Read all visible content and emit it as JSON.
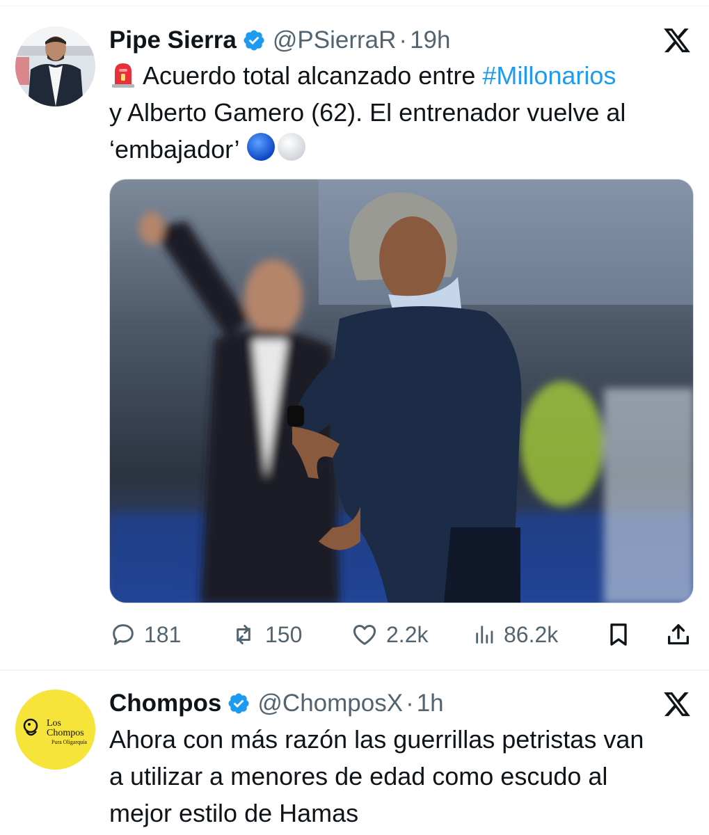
{
  "tweets": [
    {
      "display_name": "Pipe Sierra",
      "handle": "@PSierraR",
      "separator": "·",
      "time": "19h",
      "verified_icon": "verified-badge-icon",
      "avatar_icon": "profile-photo",
      "more_icon": "x-logo-icon",
      "text_line1_prefix": "Acuerdo total alcanzado entre ",
      "hashtag": "#Millonarios",
      "text_line2": "y Alberto Gamero (62). El entrenador vuelve al",
      "text_line3": "‘embajador’",
      "emojis": [
        "rotating-light-emoji",
        "blue-circle-emoji",
        "white-circle-emoji"
      ],
      "media_alt": "photo",
      "actions": {
        "replies": "181",
        "reposts": "150",
        "likes": "2.2k",
        "views": "86.2k"
      }
    },
    {
      "display_name": "Chompos",
      "handle": "@ChomposX",
      "separator": "·",
      "time": "1h",
      "avatar_logo_line1": "Los",
      "avatar_logo_line2": "Chompos",
      "avatar_logo_tagline": "Pura Oligarquía",
      "text_line1": "Ahora con más razón las guerrillas petristas van",
      "text_line2": "a utilizar a menores de edad como escudo al",
      "text_line3": "mejor estilo de Hamas"
    }
  ],
  "colors": {
    "accent": "#1d9bf0",
    "text_primary": "#0f1419",
    "text_secondary": "#536471",
    "divider": "#eff3f4",
    "chompos_yellow": "#f7e43a"
  }
}
